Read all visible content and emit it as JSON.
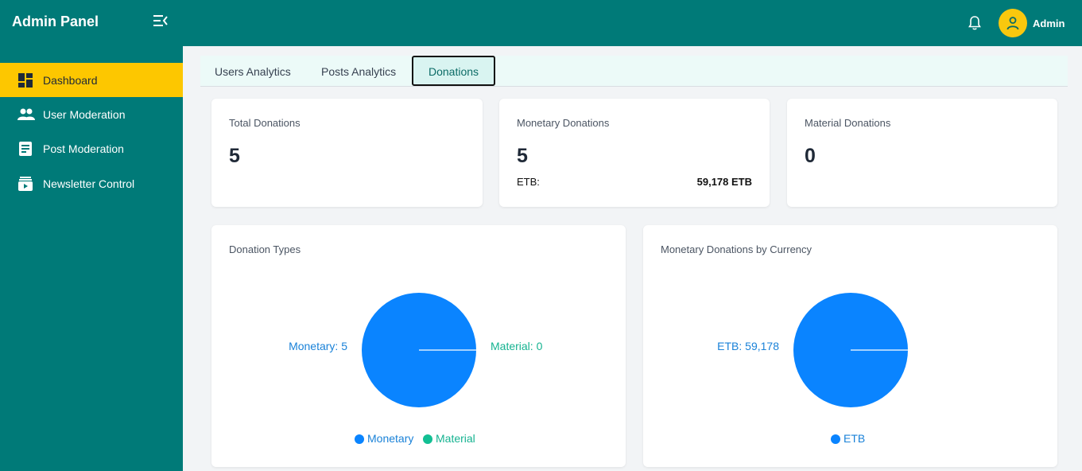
{
  "header": {
    "brand": "Admin Panel",
    "user_name": "Admin",
    "icons": [
      "menu-collapse-icon",
      "bell-icon",
      "user-icon"
    ]
  },
  "sidebar": {
    "items": [
      {
        "label": "Dashboard",
        "icon": "dashboard-icon",
        "active": true
      },
      {
        "label": "User Moderation",
        "icon": "users-icon",
        "active": false
      },
      {
        "label": "Post Moderation",
        "icon": "document-icon",
        "active": false
      },
      {
        "label": "Newsletter Control",
        "icon": "newsletter-icon",
        "active": false
      }
    ]
  },
  "tabs": [
    {
      "label": "Users Analytics",
      "active": false
    },
    {
      "label": "Posts Analytics",
      "active": false
    },
    {
      "label": "Donations",
      "active": true
    }
  ],
  "stats": {
    "total": {
      "title": "Total Donations",
      "value": "5"
    },
    "monetary": {
      "title": "Monetary Donations",
      "value": "5",
      "currency_label": "ETB:",
      "currency_value": "59,178 ETB"
    },
    "material": {
      "title": "Material Donations",
      "value": "0"
    }
  },
  "colors": {
    "brand": "#007a78",
    "active_nav": "#fdc700",
    "monetary": "#0a84ff",
    "material": "#12bf93"
  },
  "chart_data": [
    {
      "type": "pie",
      "title": "Donation Types",
      "categories": [
        "Monetary",
        "Material"
      ],
      "values": [
        5,
        0
      ],
      "data_labels": [
        "Monetary: 5",
        "Material: 0"
      ],
      "legend": [
        "Monetary",
        "Material"
      ],
      "legend_position": "bottom"
    },
    {
      "type": "pie",
      "title": "Monetary Donations by Currency",
      "categories": [
        "ETB"
      ],
      "values": [
        59178
      ],
      "data_labels": [
        "ETB: 59,178"
      ],
      "legend": [
        "ETB"
      ],
      "legend_position": "bottom"
    }
  ]
}
